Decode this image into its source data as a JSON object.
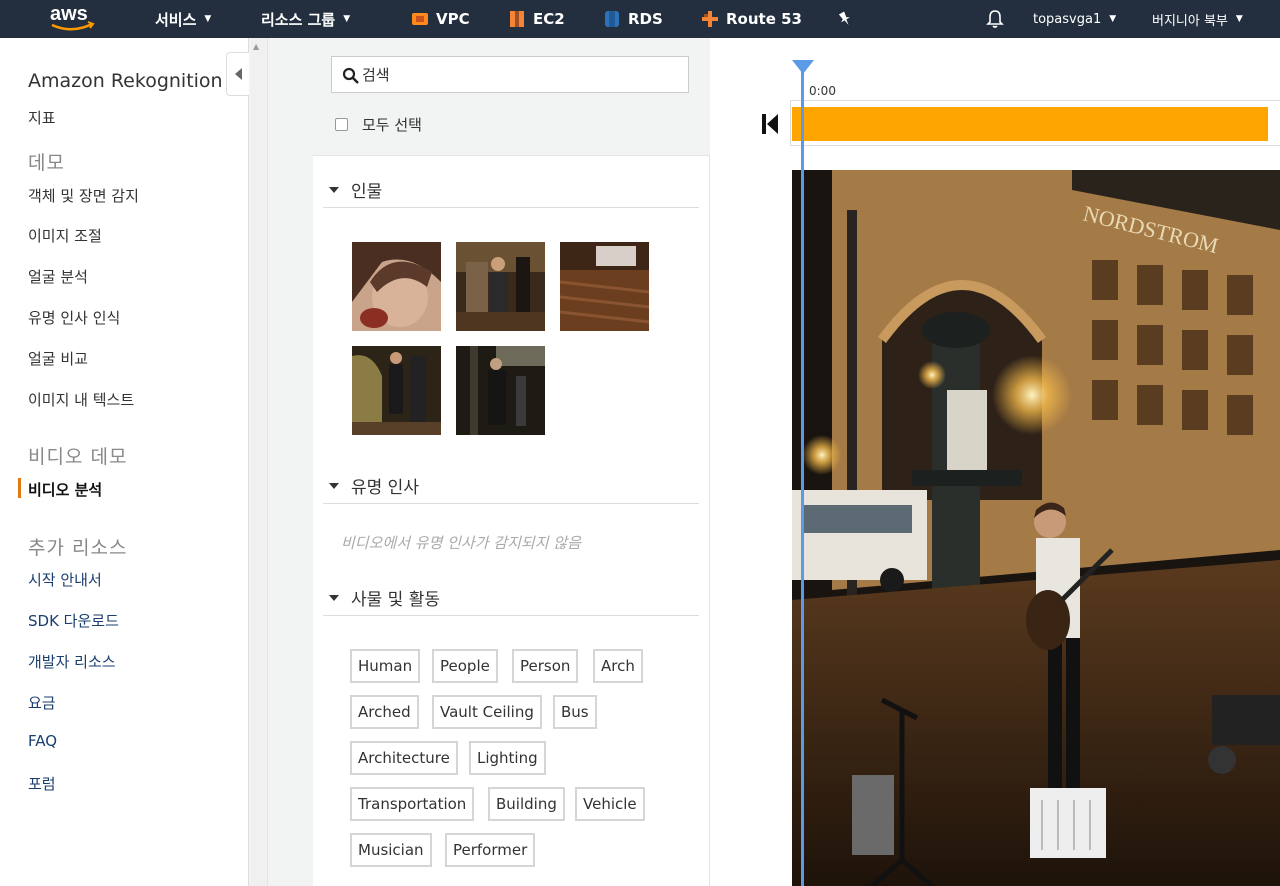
{
  "nav": {
    "services": "서비스",
    "resource_groups": "리소스 그룹",
    "shortcuts": [
      {
        "label": "VPC",
        "icon": "vpc-icon"
      },
      {
        "label": "EC2",
        "icon": "ec2-icon"
      },
      {
        "label": "RDS",
        "icon": "rds-icon"
      },
      {
        "label": "Route 53",
        "icon": "route53-icon"
      }
    ],
    "user": "topasvga1",
    "region": "버지니아 북부"
  },
  "sidebar": {
    "title": "Amazon Rekognition",
    "metrics": "지표",
    "demo_header": "데모",
    "demo_items": [
      "객체 및 장면 감지",
      "이미지 조절",
      "얼굴 분석",
      "유명 인사 인식",
      "얼굴 비교",
      "이미지 내 텍스트"
    ],
    "video_header": "비디오 데모",
    "video_items": [
      "비디오 분석"
    ],
    "resources_header": "추가 리소스",
    "resource_items": [
      "시작 안내서",
      "SDK 다운로드",
      "개발자 리소스",
      "요금",
      "FAQ",
      "포럼"
    ]
  },
  "panel": {
    "search_placeholder": "검색",
    "select_all": "모두 선택",
    "people_header": "인물",
    "celebrities_header": "유명 인사",
    "no_celebrities": "비디오에서 유명 인사가 감지되지 않음",
    "objects_header": "사물 및 활동",
    "tags": [
      "Human",
      "People",
      "Person",
      "Arch",
      "Arched",
      "Vault Ceiling",
      "Bus",
      "Architecture",
      "Lighting",
      "Transportation",
      "Building",
      "Vehicle",
      "Musician",
      "Performer"
    ]
  },
  "player": {
    "time": "0:00"
  },
  "colors": {
    "nav_bg": "#232f3e",
    "timeline": "#ffa500",
    "playhead": "#5b9be6",
    "active_marker": "#e47911"
  }
}
